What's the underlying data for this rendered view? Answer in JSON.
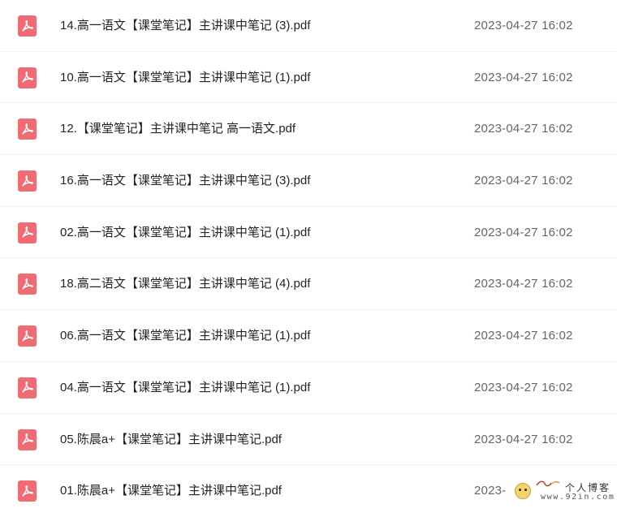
{
  "icon": "pdf-file-icon",
  "colors": {
    "icon_bg": "#f06b73",
    "name_text": "#1f2329",
    "date_text": "#5f6670",
    "divider": "#eef0f3"
  },
  "files": [
    {
      "name": "14.高一语文【课堂笔记】主讲课中笔记 (3).pdf",
      "date": "2023-04-27 16:02"
    },
    {
      "name": "10.高一语文【课堂笔记】主讲课中笔记 (1).pdf",
      "date": "2023-04-27 16:02"
    },
    {
      "name": "12.【课堂笔记】主讲课中笔记 高一语文.pdf",
      "date": "2023-04-27 16:02"
    },
    {
      "name": "16.高一语文【课堂笔记】主讲课中笔记 (3).pdf",
      "date": "2023-04-27 16:02"
    },
    {
      "name": "02.高一语文【课堂笔记】主讲课中笔记 (1).pdf",
      "date": "2023-04-27 16:02"
    },
    {
      "name": "18.高二语文【课堂笔记】主讲课中笔记 (4).pdf",
      "date": "2023-04-27 16:02"
    },
    {
      "name": "06.高一语文【课堂笔记】主讲课中笔记 (1).pdf",
      "date": "2023-04-27 16:02"
    },
    {
      "name": "04.高一语文【课堂笔记】主讲课中笔记 (1).pdf",
      "date": "2023-04-27 16:02"
    },
    {
      "name": "05.陈晨a+【课堂笔记】主讲课中笔记.pdf",
      "date": "2023-04-27 16:02"
    },
    {
      "name": "01.陈晨a+【课堂笔记】主讲课中笔记.pdf",
      "date": "2023-"
    }
  ],
  "watermark": {
    "title": "个人博客",
    "url": "www.92in.com"
  }
}
